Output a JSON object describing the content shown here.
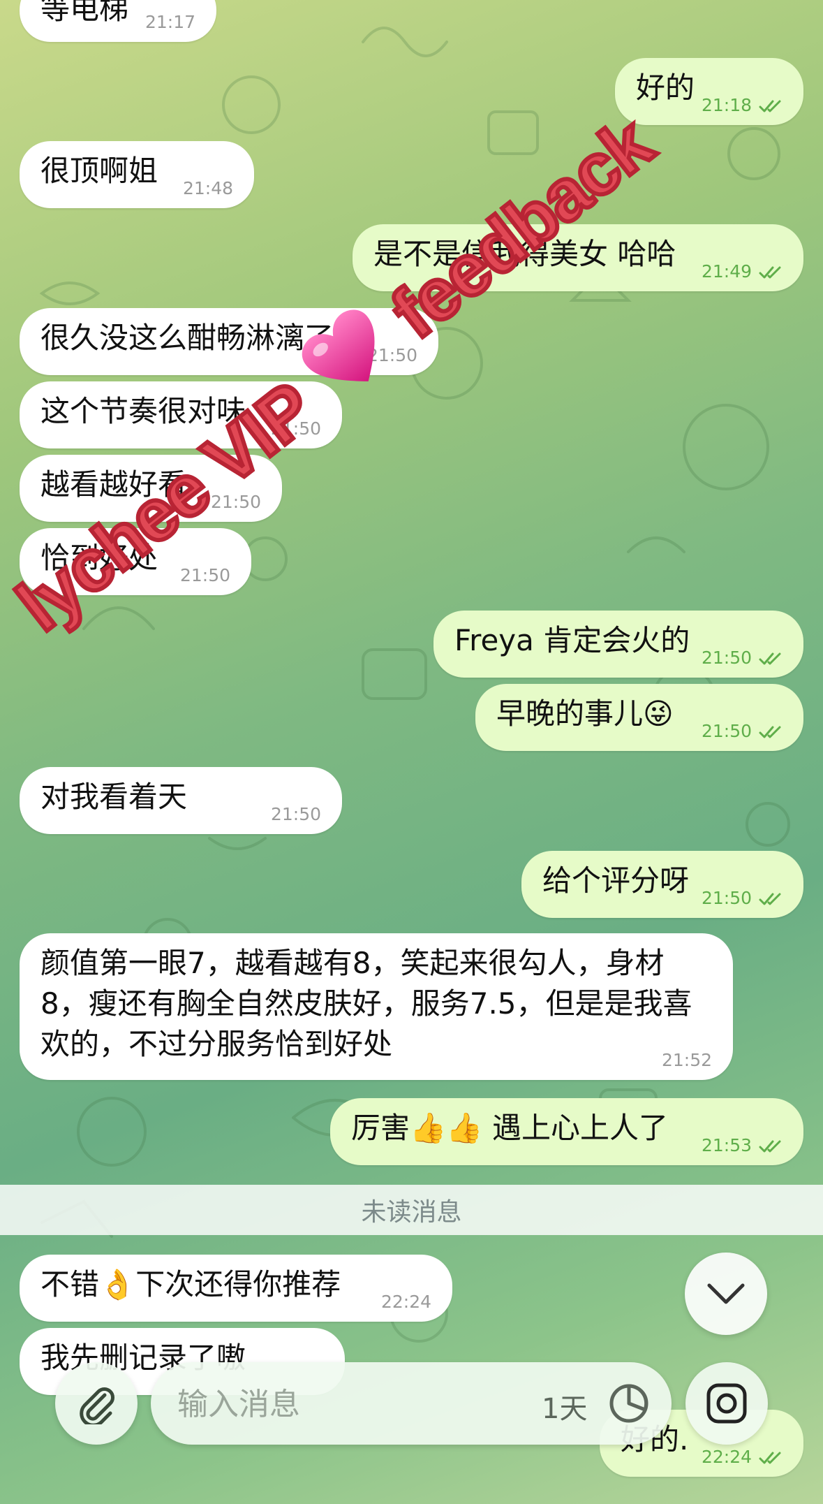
{
  "messages": [
    {
      "dir": "in",
      "text": "等电梯",
      "time": "21:17"
    },
    {
      "dir": "out",
      "text": "好的",
      "time": "21:18"
    },
    {
      "dir": "in",
      "text": "很顶啊姐",
      "time": "21:48"
    },
    {
      "dir": "out",
      "text": "是不是信我得美女 哈哈",
      "time": "21:49"
    },
    {
      "dir": "in",
      "text": "很久没这么酣畅淋漓了",
      "time": "21:50"
    },
    {
      "dir": "in",
      "text": "这个节奏很对味",
      "time": "21:50"
    },
    {
      "dir": "in",
      "text": "越看越好看",
      "time": "21:50"
    },
    {
      "dir": "in",
      "text": "恰到好处",
      "time": "21:50"
    },
    {
      "dir": "out",
      "text": "Freya 肯定会火的",
      "time": "21:50"
    },
    {
      "dir": "out",
      "text": "早晚的事儿😜",
      "time": "21:50"
    },
    {
      "dir": "in",
      "text": "对我看着天",
      "time": "21:50"
    },
    {
      "dir": "out",
      "text": "给个评分呀",
      "time": "21:50"
    },
    {
      "dir": "in",
      "text": "颜值第一眼7，越看越有8，笑起来很勾人，身材8，瘦还有胸全自然皮肤好，服务7.5，但是是我喜欢的，不过分服务恰到好处",
      "time": "21:52"
    },
    {
      "dir": "out",
      "text": "厉害👍👍 遇上心上人了",
      "time": "21:53"
    },
    {
      "dir": "in",
      "text": "不错👌下次还得你推荐",
      "time": "22:24"
    },
    {
      "dir": "in",
      "text": "我先删记录了嗷",
      "time": ""
    },
    {
      "dir": "out",
      "text": "好的.",
      "time": "22:24"
    }
  ],
  "unread_divider": "未读消息",
  "composer": {
    "placeholder": "输入消息",
    "timer_label": "1天"
  },
  "watermark": {
    "left_text": "lychee VIP",
    "right_text": "feedback",
    "color": "#e14855"
  },
  "colors": {
    "incoming_bubble": "#ffffff",
    "outgoing_bubble": "#e6fbc8",
    "outgoing_time": "#5fae4a"
  }
}
